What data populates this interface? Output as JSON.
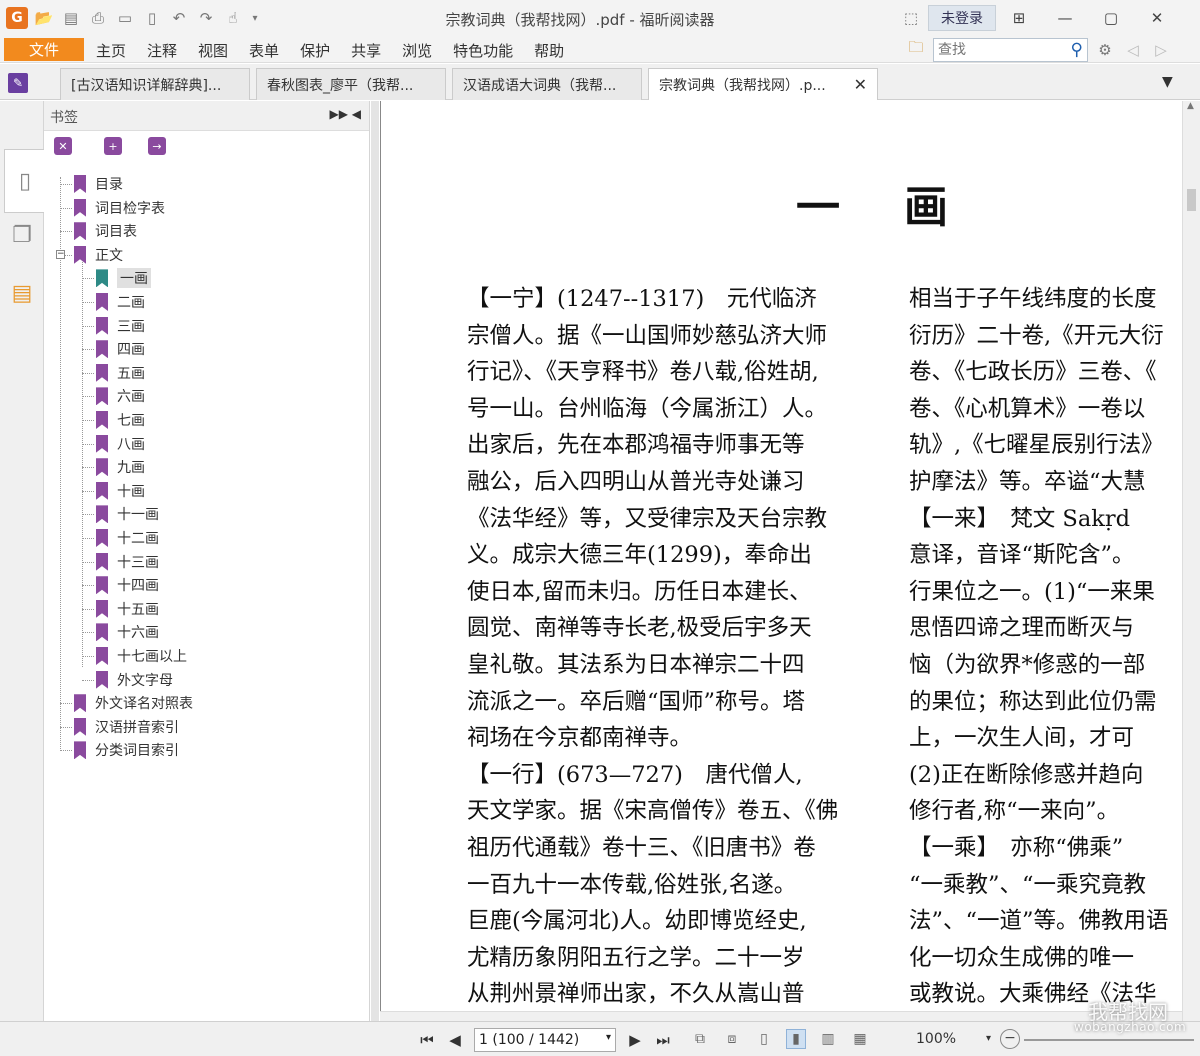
{
  "titlebar": {
    "title": "宗教词典（我帮找网）.pdf - 福昕阅读器",
    "login": "未登录"
  },
  "menu": {
    "file": "文件",
    "items": [
      "主页",
      "注释",
      "视图",
      "表单",
      "保护",
      "共享",
      "浏览",
      "特色功能",
      "帮助"
    ],
    "search_placeholder": "查找"
  },
  "tabs": [
    {
      "label": "[古汉语知识详解辞典]..."
    },
    {
      "label": "春秋图表_廖平（我帮..."
    },
    {
      "label": "汉语成语大词典（我帮..."
    },
    {
      "label": "宗教词典（我帮找网）.p..."
    }
  ],
  "bookmarks": {
    "title": "书签",
    "items": [
      {
        "label": "目录"
      },
      {
        "label": "词目检字表"
      },
      {
        "label": "词目表"
      },
      {
        "label": "正文"
      },
      {
        "label": "一画"
      },
      {
        "label": "二画"
      },
      {
        "label": "三画"
      },
      {
        "label": "四画"
      },
      {
        "label": "五画"
      },
      {
        "label": "六画"
      },
      {
        "label": "七画"
      },
      {
        "label": "八画"
      },
      {
        "label": "九画"
      },
      {
        "label": "十画"
      },
      {
        "label": "十一画"
      },
      {
        "label": "十二画"
      },
      {
        "label": "十三画"
      },
      {
        "label": "十四画"
      },
      {
        "label": "十五画"
      },
      {
        "label": "十六画"
      },
      {
        "label": "十七画以上"
      },
      {
        "label": "外文字母"
      },
      {
        "label": "外文译名对照表"
      },
      {
        "label": "汉语拼音索引"
      },
      {
        "label": "分类词目索引"
      }
    ]
  },
  "document": {
    "heading": "一画",
    "left_lines": [
      "【一宁】(1247--1317)　元代临济",
      "宗僧人。据《一山国师妙慈弘济大师",
      "行记》、《天亨释书》卷八载,俗姓胡,",
      "号一山。台州临海（今属浙江）人。",
      "出家后，先在本郡鸿福寺师事无等",
      "融公，后入四明山从普光寺处谦习",
      "《法华经》等，又受律宗及天台宗教",
      "义。成宗大德三年(1299)，奉命出",
      "使日本,留而未归。历任日本建长、",
      "圆觉、南禅等寺长老,极受后宇多天",
      "皇礼敬。其法系为日本禅宗二十四",
      "流派之一。卒后赠“国师”称号。塔",
      "祠场在今京都南禅寺。",
      "【一行】(673—727)　唐代僧人,",
      "天文学家。据《宋高僧传》卷五、《佛",
      "祖历代通载》卷十三、《旧唐书》卷",
      "一百九十一本传载,俗姓张,名遂。",
      "巨鹿(今属河北)人。幼即博览经史,",
      "尤精历象阴阳五行之学。二十一岁",
      "从荆州景禅师出家，不久从嵩山普"
    ],
    "right_lines": [
      "相当于子午线纬度的长度",
      "衍历》二十卷,《开元大衍",
      "卷、《七政长历》三卷、《",
      "卷、《心机算术》一卷以",
      "轨》,《七曜星辰别行法》",
      "护摩法》等。卒谥“大慧",
      "【一来】　梵文 Sakṛd",
      "意译，音译“斯陀含”。",
      "行果位之一。(1)“一来果",
      "思悟四谛之理而断灭与",
      "恼（为欲界*修惑的一部",
      "的果位；称达到此位仍需",
      "上，一次生人间，才可",
      "(2)正在断除修惑并趋向",
      "修行者,称“一来向”。",
      "【一乘】　亦称“佛乘”",
      "“一乘教”、“一乘究竟教",
      "法”、“一道”等。佛教用语",
      "化一切众生成佛的唯一",
      "或教说。大乘佛经《法华"
    ]
  },
  "status": {
    "page": "1 (100 / 1442)",
    "zoom": "100%"
  },
  "watermark": {
    "main": "我帮找网",
    "sub": "wobangzhao.com"
  }
}
